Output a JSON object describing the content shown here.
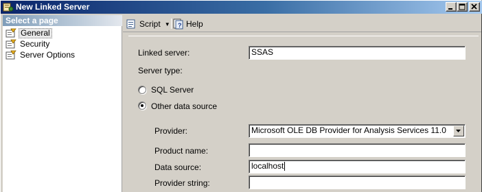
{
  "window": {
    "title": "New Linked Server",
    "icons": {
      "app": "linked-server-icon",
      "minimize": "minimize-icon",
      "maximize": "maximize-icon",
      "close": "close-icon"
    }
  },
  "sidebar": {
    "header": "Select a page",
    "items": [
      {
        "label": "General",
        "icon": "page-icon",
        "selected": true
      },
      {
        "label": "Security",
        "icon": "page-icon",
        "selected": false
      },
      {
        "label": "Server Options",
        "icon": "page-icon",
        "selected": false
      }
    ]
  },
  "toolbar": {
    "script_label": "Script",
    "help_label": "Help"
  },
  "form": {
    "linked_server_label": "Linked server:",
    "linked_server_value": "SSAS",
    "server_type_label": "Server type:",
    "sql_server_label": "SQL Server",
    "sql_server_checked": false,
    "other_source_label": "Other data source",
    "other_source_checked": true,
    "provider_label": "Provider:",
    "provider_value": "Microsoft OLE DB Provider for Analysis Services 11.0",
    "product_name_label": "Product name:",
    "product_name_value": "",
    "data_source_label": "Data source:",
    "data_source_value": "localhost",
    "provider_string_label": "Provider string:",
    "provider_string_value": ""
  },
  "colors": {
    "title_start": "#0a246a",
    "title_end": "#a6caf0",
    "sidebar_header": "#7f9db9",
    "dialog_face": "#d4d0c8"
  }
}
